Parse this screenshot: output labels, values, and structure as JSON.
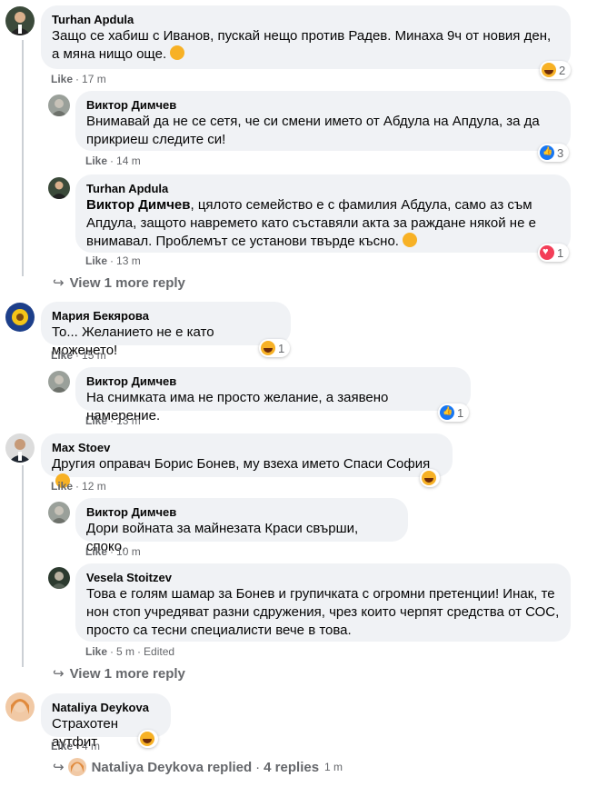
{
  "colors": {
    "bubble": "#f0f2f5",
    "meta": "#65676b",
    "link": "#1877f2"
  },
  "comments": [
    {
      "author": "Turhan Apdula",
      "text": "Защо се хабиш с Иванов, пускай нещо против Радев. Минаха 9ч от новия ден, а мяна нищо още.",
      "like": "Like",
      "time": "17 m",
      "reaction_icon": "haha-emoji-icon",
      "reaction_count": "2"
    },
    {
      "author": "Виктор Димчев",
      "text": "Внимавай да не се сетя, че си смени името от Абдула на Апдула, за да прикриеш следите си!",
      "like": "Like",
      "time": "14 m",
      "reaction_icon": "like-reaction-icon",
      "reaction_count": "3"
    },
    {
      "author": "Turhan Apdula",
      "mention": "Виктор Димчев",
      "text": ", цялото семейство е с фамилия Абдула, само аз съм Апдула, защото навремето като съставяли акта за раждане някой не е внимавал. Проблемът се установи твърде късно.",
      "like": "Like",
      "time": "13 m",
      "reaction_icon": "love-reaction-icon",
      "reaction_count": "1"
    },
    {
      "author": "Мария Бекярова",
      "text": "То... Желанието не е като моженето!",
      "like": "Like",
      "time": "15 m",
      "reaction_icon": "haha-emoji-icon",
      "reaction_count": "1"
    },
    {
      "author": "Виктор Димчев",
      "text": "На снимката има не просто желание, а заявено намерение.",
      "like": "Like",
      "time": "13 m",
      "reaction_icon": "like-reaction-icon",
      "reaction_count": "1"
    },
    {
      "author": "Max Stoev",
      "text": "Другия оправач Борис Бонев, му взеха името Спаси София",
      "like": "Like",
      "time": "12 m",
      "reaction_icon": "haha-emoji-icon",
      "reaction_count": ""
    },
    {
      "author": "Виктор Димчев",
      "text": "Дори войната за майнезата Краси свърши, споко.",
      "like": "Like",
      "time": "10 m"
    },
    {
      "author": "Vesela Stoitzev",
      "text": "Това е голям шамар за Бонев и групичката с огромни претенции! Инак, те нон стоп учредяват разни сдружения, чрез които черпят средства от СОС, просто са тесни специалисти вече в това.",
      "like": "Like",
      "time": "5 m",
      "edited": "Edited"
    },
    {
      "author": "Nataliya Deykova",
      "text": "Страхотен аутфит",
      "like": "Like",
      "time": "4 m",
      "reaction_icon": "haha-emoji-icon",
      "reaction_count": ""
    }
  ],
  "view_more_1": "View 1 more reply",
  "view_more_2": "View 1 more reply",
  "replied": {
    "name": "Nataliya Deykova",
    "action": "replied",
    "count": "4 replies",
    "time": "1 m"
  }
}
